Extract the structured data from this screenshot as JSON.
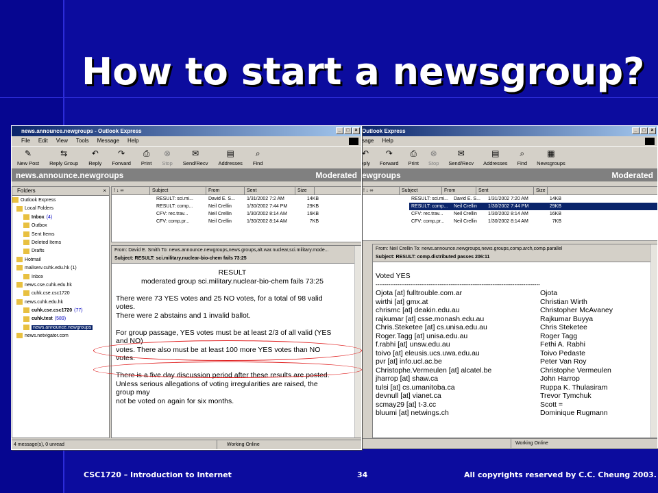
{
  "slide": {
    "title": "How to start a newsgroup?",
    "footer_left": "CSC1720 – Introduction  to Internet",
    "page_number": "34",
    "footer_right": "All copyrights reserved by C.C. Cheung 2003."
  },
  "window_left": {
    "title": "news.announce.newgroups - Outlook Express",
    "menu": [
      "File",
      "Edit",
      "View",
      "Tools",
      "Message",
      "Help"
    ],
    "toolbar": [
      "New Post",
      "Reply Group",
      "Reply",
      "Forward",
      "Print",
      "Stop",
      "Send/Recv",
      "Addresses",
      "Find"
    ],
    "folder_title": "news.announce.newgroups",
    "moderated": "Moderated",
    "folders_label": "Folders",
    "folders": [
      "Outlook Express",
      "Local Folders",
      "Inbox",
      "Outbox",
      "Sent Items",
      "Deleted Items",
      "Drafts",
      "Hotmail",
      "mailserv.cuhk.edu.hk (1)",
      "Inbox",
      "news.cse.cuhk.edu.hk",
      "cuhk.cse.csc1720",
      "news.cuhk.edu.hk",
      "cuhk.cse.csc1720",
      "cuhk.test",
      "news.announce.newgroups",
      "news.netvigator.com"
    ],
    "inbox_count": "(4)",
    "csc1720_count": "(77)",
    "test_count": "(589)",
    "columns": [
      "Subject",
      "From",
      "Sent",
      "Size"
    ],
    "messages": [
      {
        "subject": "RESULT: sci.mi...",
        "from": "David E. S...",
        "sent": "1/31/2002 7:2 AM",
        "size": "14KB"
      },
      {
        "subject": "RESULT: comp...",
        "from": "Neil Crellin",
        "sent": "1/30/2002 7:44 PM",
        "size": "29KB"
      },
      {
        "subject": "CFV: rec.trav...",
        "from": "Neil Crellin",
        "sent": "1/30/2002 8:14 AM",
        "size": "16KB"
      },
      {
        "subject": "CFV: comp.pr...",
        "from": "Neil Crellin",
        "sent": "1/30/2002 8:14 AM",
        "size": "7KB"
      }
    ],
    "preview_from": "From:  David E. Smith    To:  news.announce.newgroups,news.groups,alt.war.nuclear,sci.military.mode...",
    "preview_subject": "Subject:  RESULT: sci.military.nuclear-bio-chem fails 73:25",
    "body": [
      "RESULT",
      "moderated group sci.military.nuclear-bio-chem fails 73:25",
      "",
      "There were 73 YES votes and 25 NO votes, for a total of 98 valid",
      "votes.",
      "There were 2 abstains and 1 invalid ballot.",
      "",
      "For group passage, YES votes must be at least 2/3 of all valid (YES",
      "and NO)",
      "votes.   There also must be at least 100 more YES votes than NO",
      "votes.",
      "",
      "There is a five day discussion period after these results are posted.",
      "Unless serious allegations of voting irregularities are raised, the",
      "group may",
      "not be voted on again for six months."
    ],
    "status_left": "4 message(s), 0 unread",
    "status_right": "Working Online"
  },
  "window_right": {
    "title": "Outlook Express",
    "menu": [
      "sage",
      "Help"
    ],
    "toolbar": [
      "eply",
      "Forward",
      "Print",
      "Stop",
      "Send/Recv",
      "Addresses",
      "Find",
      "Newsgroups"
    ],
    "folder_title": "ewgroups",
    "moderated": "Moderated",
    "columns": [
      "Subject",
      "From",
      "Sent",
      "Size"
    ],
    "messages": [
      {
        "subject": "RESULT: sci.mi...",
        "from": "David E. S...",
        "sent": "1/31/2002 7:20 AM",
        "size": "14KB"
      },
      {
        "subject": "RESULT: comp...",
        "from": "Neil Crellin",
        "sent": "1/30/2002 7:44 PM",
        "size": "29KB"
      },
      {
        "subject": "CFV: rec.trav...",
        "from": "Neil Crellin",
        "sent": "1/30/2002 8:14 AM",
        "size": "16KB"
      },
      {
        "subject": "CFV: comp.pr...",
        "from": "Neil Crellin",
        "sent": "1/30/2002 8:14 AM",
        "size": "7KB"
      }
    ],
    "preview_from": "From:  Neil Crellin    To:  news.announce.newgroups,news.groups,comp.arch,comp.parallel",
    "preview_subject": "Subject:  RESULT: comp.distributed passes 206:11",
    "voted_heading": "Voted YES",
    "divider": "------------------------------------------------------------------------------------------",
    "voters": [
      {
        "email": "Ojota [at] fulltrouble.com.ar",
        "name": "Ojota"
      },
      {
        "email": "wirthi [at] gmx.at",
        "name": "Christian Wirth"
      },
      {
        "email": "chrismc [at] deakin.edu.au",
        "name": "Christopher McAvaney"
      },
      {
        "email": "rajkumar [at] csse.monash.edu.au",
        "name": "Rajkumar Buyya"
      },
      {
        "email": "Chris.Steketee [at] cs.unisa.edu.au",
        "name": "Chris Steketee"
      },
      {
        "email": "Roger.Tagg [at] unisa.edu.au",
        "name": "Roger Tagg"
      },
      {
        "email": "f.rabhi [at] unsw.edu.au",
        "name": "Fethi A. Rabhi"
      },
      {
        "email": "toivo [at] eleusis.ucs.uwa.edu.au",
        "name": "Toivo Pedaste"
      },
      {
        "email": "pvr [at] info.ucl.ac.be",
        "name": "Peter Van Roy"
      },
      {
        "email": "Christophe.Vermeulen [at] alcatel.be",
        "name": "Christophe Vermeulen"
      },
      {
        "email": "jharrop [at] shaw.ca",
        "name": "John Harrop"
      },
      {
        "email": "tulsi [at] cs.umanitoba.ca",
        "name": "Ruppa K. Thulasiram"
      },
      {
        "email": "devnull [at] vianet.ca",
        "name": "Trevor Tymchuk"
      },
      {
        "email": "scmay29 [at] t-3.cc",
        "name": "Scott ="
      },
      {
        "email": "bluumi [at] netwings.ch",
        "name": "Dominique Rugmann"
      }
    ],
    "status_right": "Working Online"
  }
}
